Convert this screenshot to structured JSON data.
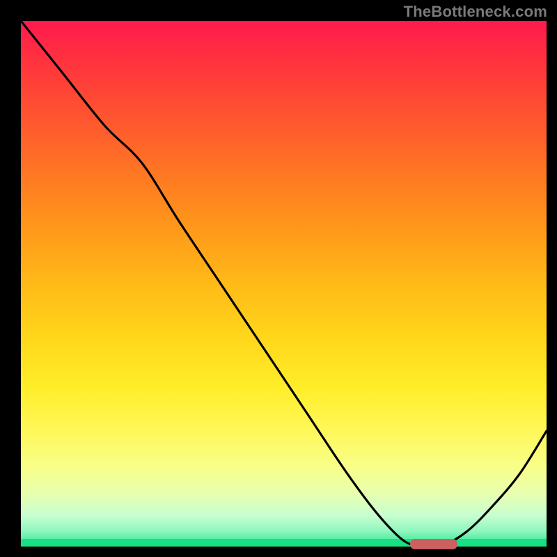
{
  "attribution": "TheBottleneck.com",
  "colors": {
    "page_bg": "#000000",
    "gradient_top": "#ff1a4d",
    "gradient_bottom": "#19e084",
    "curve": "#000000",
    "marker": "#cc5f5f",
    "attribution_text": "#7a7a7a"
  },
  "chart_data": {
    "type": "line",
    "title": "",
    "xlabel": "",
    "ylabel": "",
    "xlim": [
      0,
      100
    ],
    "ylim": [
      0,
      100
    ],
    "grid": false,
    "legend": false,
    "series": [
      {
        "name": "curve",
        "x": [
          0,
          8,
          16,
          23,
          30,
          38,
          46,
          54,
          62,
          68,
          73,
          77,
          80,
          85,
          90,
          95,
          100
        ],
        "y": [
          100,
          90,
          80,
          73,
          62,
          50,
          38,
          26,
          14,
          6,
          1,
          0,
          0,
          3,
          8,
          14,
          22
        ]
      }
    ],
    "marker": {
      "x_start": 74,
      "x_end": 83,
      "y": 0.5,
      "color": "#cc5f5f"
    },
    "background": {
      "type": "vertical-gradient",
      "description": "red at top through orange/yellow to green at bottom"
    }
  }
}
